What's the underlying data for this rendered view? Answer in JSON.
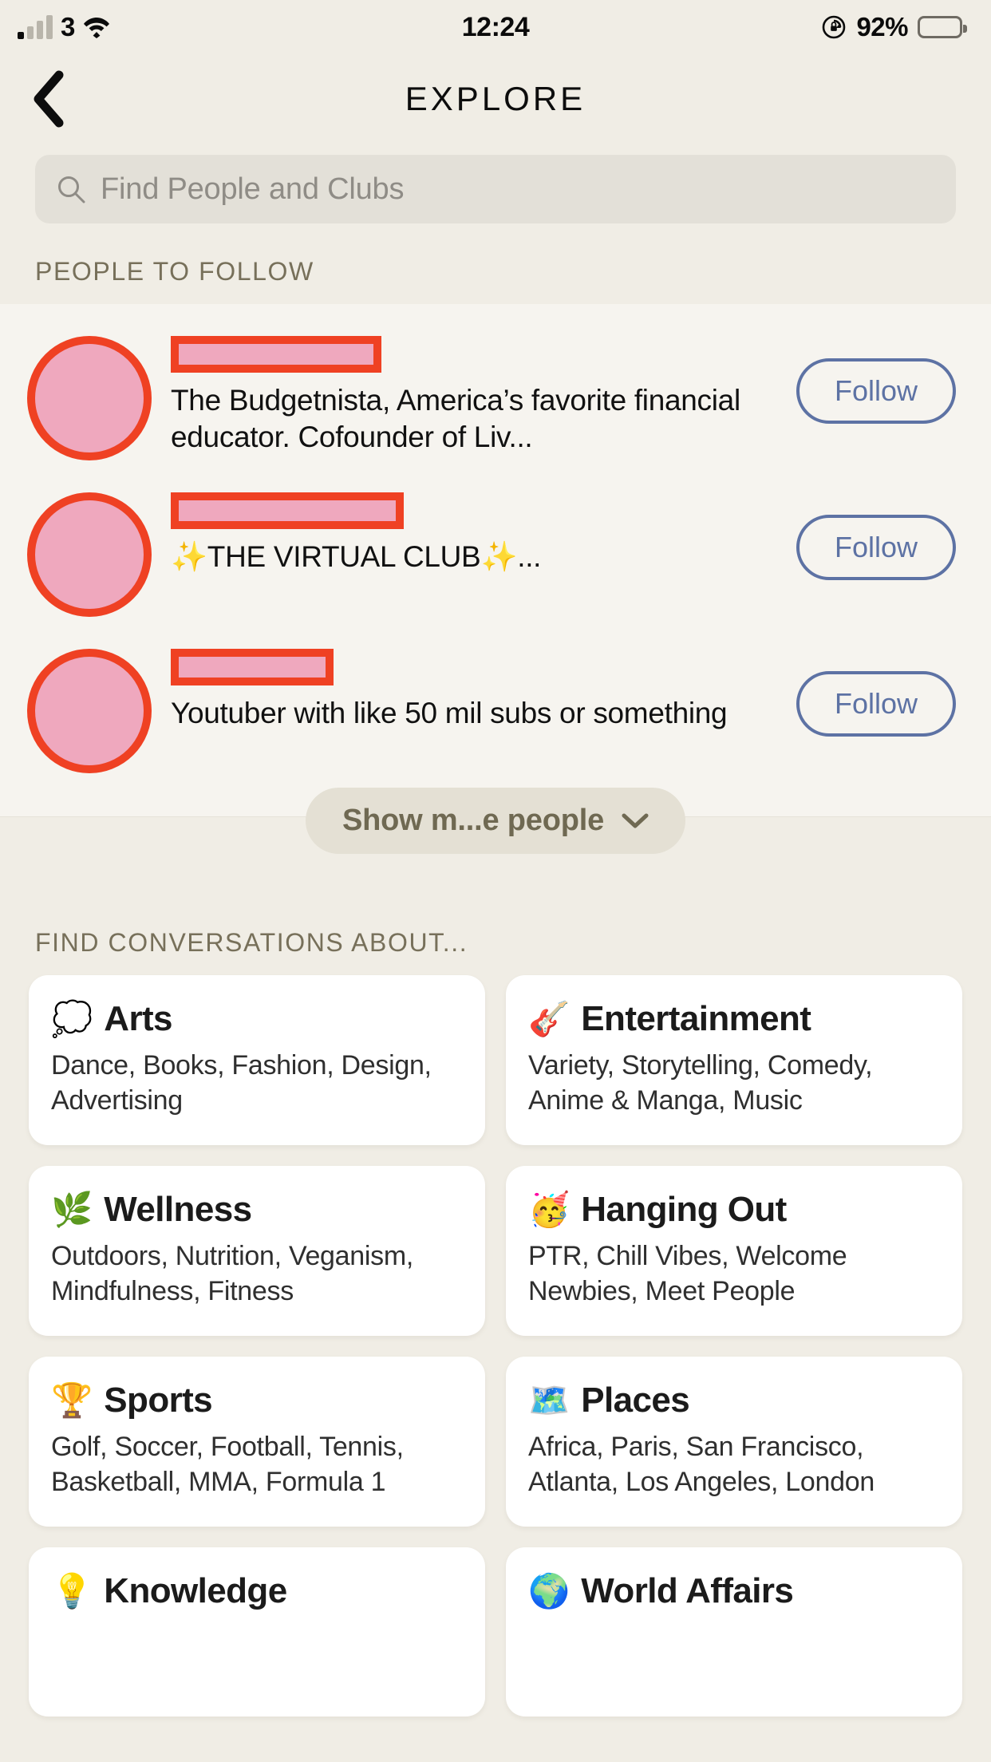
{
  "status_bar": {
    "carrier": "3",
    "time": "12:24",
    "battery_percent": "92%",
    "signal_icon": "signal-bars-icon",
    "wifi_icon": "wifi-icon",
    "lock_icon": "rotation-lock-icon",
    "battery_icon": "battery-icon"
  },
  "nav": {
    "back_icon": "back-chevron-icon",
    "title": "EXPLORE"
  },
  "search": {
    "icon": "search-icon",
    "placeholder": "Find People and Clubs",
    "value": ""
  },
  "people": {
    "section_label": "PEOPLE TO FOLLOW",
    "follow_label": "Follow",
    "rows": [
      {
        "name_redacted": true,
        "bio": "The Budgetnista, America’s favorite financial educator. Cofounder of Liv...",
        "follow_label": "Follow"
      },
      {
        "name_redacted": true,
        "bio": "✨THE VIRTUAL CLUB✨...",
        "follow_label": "Follow"
      },
      {
        "name_redacted": true,
        "bio": "Youtuber with like 50 mil subs or something",
        "follow_label": "Follow"
      }
    ],
    "show_more_label": "Show m...e people",
    "show_more_icon": "chevron-down-icon"
  },
  "conversations": {
    "section_label": "FIND CONVERSATIONS ABOUT...",
    "categories": [
      {
        "emoji": "💭",
        "icon_name": "thought-balloon-icon",
        "title": "Arts",
        "subtitle": "Dance, Books, Fashion, Design, Advertising"
      },
      {
        "emoji": "🎸",
        "icon_name": "guitar-icon",
        "title": "Entertainment",
        "subtitle": "Variety, Storytelling, Comedy, Anime & Manga, Music"
      },
      {
        "emoji": "🌿",
        "icon_name": "herb-icon",
        "title": "Wellness",
        "subtitle": "Outdoors, Nutrition, Veganism, Mindfulness, Fitness"
      },
      {
        "emoji": "🥳",
        "icon_name": "partying-face-icon",
        "title": "Hanging Out",
        "subtitle": "PTR, Chill Vibes, Welcome Newbies, Meet People"
      },
      {
        "emoji": "🏆",
        "icon_name": "trophy-icon",
        "title": "Sports",
        "subtitle": "Golf, Soccer, Football, Tennis, Basketball, MMA, Formula 1"
      },
      {
        "emoji": "🗺️",
        "icon_name": "world-map-icon",
        "title": "Places",
        "subtitle": "Africa, Paris, San Francisco, Atlanta, Los Angeles, London"
      },
      {
        "emoji": "💡",
        "icon_name": "light-bulb-icon",
        "title": "Knowledge",
        "subtitle": ""
      },
      {
        "emoji": "🌍",
        "icon_name": "globe-europe-africa-icon",
        "title": "World Affairs",
        "subtitle": ""
      }
    ]
  },
  "colors": {
    "background": "#f0ede5",
    "panel": "#f6f4ef",
    "card": "#ffffff",
    "section_label": "#77705a",
    "follow_accent": "#5d72a4",
    "redaction_border": "#ef4123",
    "redaction_fill": "#efa8be",
    "show_more_pill": "#e4e0d4",
    "search_field": "#e3e0d8"
  }
}
